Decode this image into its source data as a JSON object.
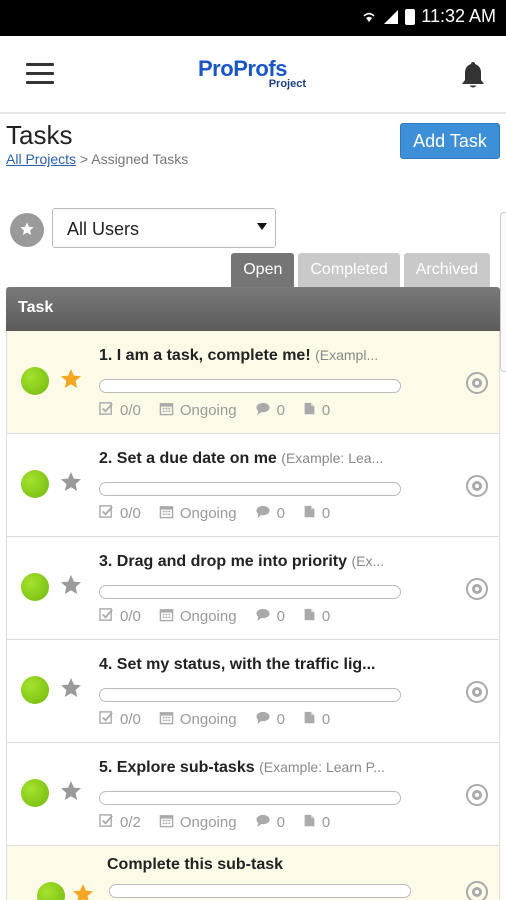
{
  "status_bar": {
    "time": "11:32 AM",
    "icons": [
      "wifi-icon",
      "signal-icon",
      "battery-icon"
    ]
  },
  "app_bar": {
    "logo_brand_1": "Pro",
    "logo_brand_2": "Profs",
    "logo_sub": "Project",
    "menu_icon": "hamburger-icon",
    "notification_icon": "bell-icon"
  },
  "header": {
    "title": "Tasks",
    "breadcrumb_link": "All Projects",
    "breadcrumb_separator": ">",
    "breadcrumb_current": "Assigned Tasks",
    "add_task_label": "Add Task"
  },
  "filter": {
    "user_select_value": "All Users"
  },
  "tabs": [
    {
      "label": "Open",
      "active": true
    },
    {
      "label": "Completed",
      "active": false
    },
    {
      "label": "Archived",
      "active": false
    }
  ],
  "table": {
    "column_header": "Task"
  },
  "tasks": [
    {
      "title": "1. I am a task, complete me!",
      "hint": "(Exampl...",
      "checklist": "0/0",
      "due": "Ongoing",
      "comments": "0",
      "files": "0",
      "starred": true,
      "highlight": true
    },
    {
      "title": "2. Set a due date on me",
      "hint": "(Example: Lea...",
      "checklist": "0/0",
      "due": "Ongoing",
      "comments": "0",
      "files": "0",
      "starred": false,
      "highlight": false
    },
    {
      "title": "3. Drag and drop me into priority",
      "hint": "(Ex...",
      "checklist": "0/0",
      "due": "Ongoing",
      "comments": "0",
      "files": "0",
      "starred": false,
      "highlight": false
    },
    {
      "title": "4. Set my status, with the traffic lig...",
      "hint": "",
      "checklist": "0/0",
      "due": "Ongoing",
      "comments": "0",
      "files": "0",
      "starred": false,
      "highlight": false
    },
    {
      "title": "5. Explore sub-tasks",
      "hint": "(Example: Learn P...",
      "checklist": "0/2",
      "due": "Ongoing",
      "comments": "0",
      "files": "0",
      "starred": false,
      "highlight": false
    }
  ],
  "subtask": {
    "title": "Complete this sub-task",
    "starred": true
  },
  "colors": {
    "accent_blue": "#3d8fd8",
    "status_green": "#7cc512",
    "star_gold": "#f5a623",
    "highlight_row": "#fdfbe8"
  }
}
